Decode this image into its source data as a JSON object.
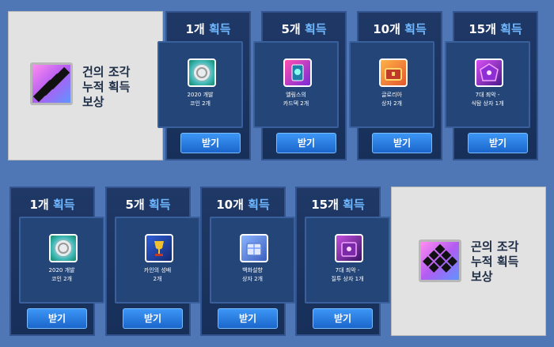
{
  "panels": [
    {
      "fragment_title": "건의 조각\n누적 획득\n보상",
      "rewards": [
        {
          "count": "1개",
          "obtain": "획득",
          "item": "2020 개발\n코인 2개",
          "icon": "dev-coin-icon",
          "button": "받기"
        },
        {
          "count": "5개",
          "obtain": "획득",
          "item": "엘림스의\n카드덱 2개",
          "icon": "card-deck-icon",
          "button": "받기"
        },
        {
          "count": "10개",
          "obtain": "획득",
          "item": "글로리아\n상자 2개",
          "icon": "gloria-chest-icon",
          "button": "받기"
        },
        {
          "count": "15개",
          "obtain": "획득",
          "item": "7대 죄악 -\n식탐 상자 1개",
          "icon": "gluttony-box-icon",
          "button": "받기"
        }
      ]
    },
    {
      "fragment_title": "곤의 조각\n누적 획득\n보상",
      "rewards": [
        {
          "count": "1개",
          "obtain": "획득",
          "item": "2020 개발\n코인 2개",
          "icon": "dev-coin-icon",
          "button": "받기"
        },
        {
          "count": "5개",
          "obtain": "획득",
          "item": "카인의 성배\n2개",
          "icon": "grail-icon",
          "button": "받기"
        },
        {
          "count": "10개",
          "obtain": "획득",
          "item": "백화설향\n상자 2개",
          "icon": "snow-box-icon",
          "button": "받기"
        },
        {
          "count": "15개",
          "obtain": "획득",
          "item": "7대 죄악 -\n질투 상자 1개",
          "icon": "envy-box-icon",
          "button": "받기"
        }
      ]
    }
  ],
  "colors": {
    "background": "#4f77b5",
    "accent": "#6fb8ff",
    "button": "#2a7fe6"
  }
}
